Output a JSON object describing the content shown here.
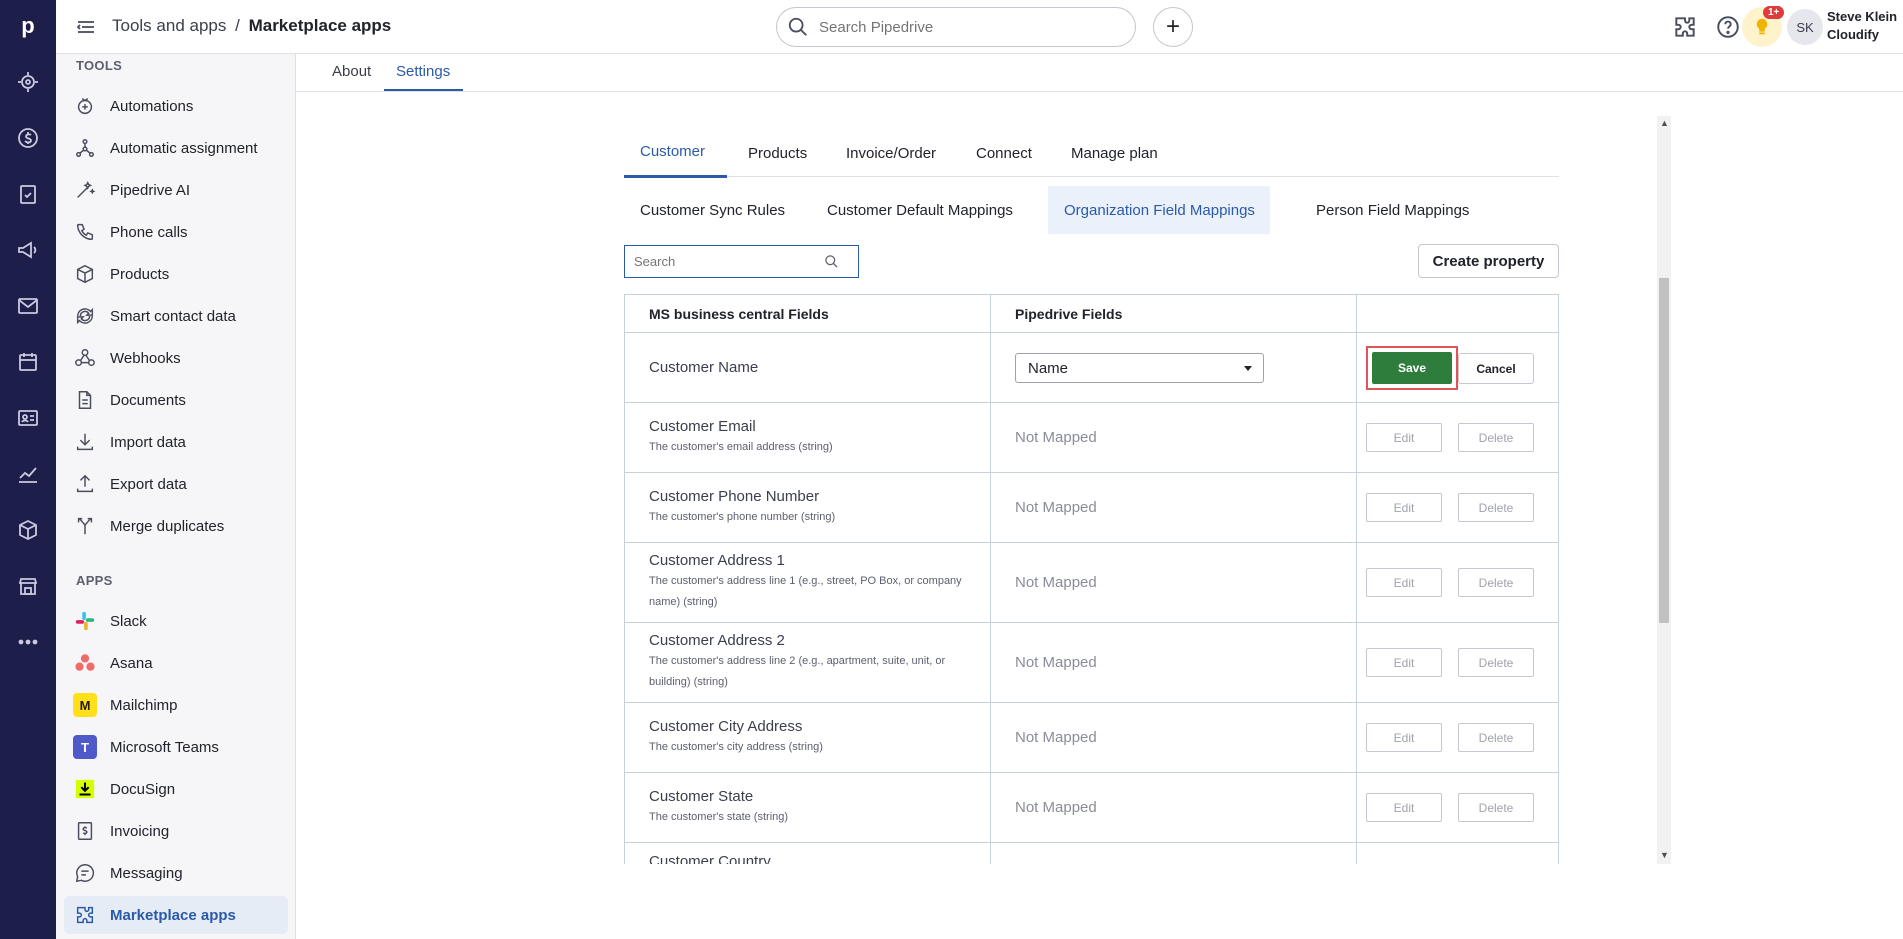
{
  "topbar": {
    "breadcrumb_parent": "Tools and apps",
    "breadcrumb_sep": "/",
    "breadcrumb_current": "Marketplace apps",
    "search_placeholder": "Search Pipedrive",
    "notifications_badge": "1+",
    "avatar_initials": "SK",
    "user_name": "Steve Klein",
    "user_company": "Cloudify"
  },
  "sidebar": {
    "tools_header": "TOOLS",
    "tools": [
      {
        "label": "Automations",
        "icon": "automations-icon"
      },
      {
        "label": "Automatic assignment",
        "icon": "assignment-icon"
      },
      {
        "label": "Pipedrive AI",
        "icon": "ai-wand-icon"
      },
      {
        "label": "Phone calls",
        "icon": "phone-icon"
      },
      {
        "label": "Products",
        "icon": "box-icon"
      },
      {
        "label": "Smart contact data",
        "icon": "sync-icon"
      },
      {
        "label": "Webhooks",
        "icon": "webhook-icon"
      },
      {
        "label": "Documents",
        "icon": "document-icon"
      },
      {
        "label": "Import data",
        "icon": "import-icon"
      },
      {
        "label": "Export data",
        "icon": "export-icon"
      },
      {
        "label": "Merge duplicates",
        "icon": "merge-icon"
      }
    ],
    "apps_header": "APPS",
    "apps": [
      {
        "label": "Slack",
        "icon": "slack-icon"
      },
      {
        "label": "Asana",
        "icon": "asana-icon"
      },
      {
        "label": "Mailchimp",
        "icon": "mailchimp-icon"
      },
      {
        "label": "Microsoft Teams",
        "icon": "teams-icon"
      },
      {
        "label": "DocuSign",
        "icon": "docusign-icon"
      },
      {
        "label": "Invoicing",
        "icon": "invoicing-icon"
      },
      {
        "label": "Messaging",
        "icon": "messaging-icon"
      },
      {
        "label": "Marketplace apps",
        "icon": "marketplace-icon"
      }
    ]
  },
  "page_tabs": [
    {
      "label": "About"
    },
    {
      "label": "Settings"
    }
  ],
  "inner_tabs": [
    {
      "label": "Customer"
    },
    {
      "label": "Products"
    },
    {
      "label": "Invoice/Order"
    },
    {
      "label": "Connect"
    },
    {
      "label": "Manage plan"
    }
  ],
  "sub_tabs": [
    {
      "label": "Customer Sync Rules"
    },
    {
      "label": "Customer Default Mappings"
    },
    {
      "label": "Organization Field Mappings"
    },
    {
      "label": "Person Field Mappings"
    }
  ],
  "table_search_placeholder": "Search",
  "create_property_label": "Create property",
  "table": {
    "headers": [
      "MS business central Fields",
      "Pipedrive Fields"
    ],
    "edit_row": {
      "field": "Customer Name",
      "selected": "Name",
      "save_label": "Save",
      "cancel_label": "Cancel"
    },
    "rows": [
      {
        "field": "Customer Email",
        "desc": "The customer's email address (string)",
        "mapping": "Not Mapped"
      },
      {
        "field": "Customer Phone Number",
        "desc": "The customer's phone number (string)",
        "mapping": "Not Mapped"
      },
      {
        "field": "Customer Address 1",
        "desc": "The customer's address line 1 (e.g., street, PO Box, or company name) (string)",
        "mapping": "Not Mapped"
      },
      {
        "field": "Customer Address 2",
        "desc": "The customer's address line 2 (e.g., apartment, suite, unit, or building) (string)",
        "mapping": "Not Mapped"
      },
      {
        "field": "Customer City Address",
        "desc": "The customer's city address (string)",
        "mapping": "Not Mapped"
      },
      {
        "field": "Customer State",
        "desc": "The customer's state (string)",
        "mapping": "Not Mapped"
      },
      {
        "field": "Customer Country",
        "desc": "",
        "mapping": ""
      }
    ],
    "edit_label": "Edit",
    "delete_label": "Delete"
  },
  "colors": {
    "rail": "#1e1e4a",
    "accent": "#2a5aa8",
    "save": "#2e7d3c",
    "highlight": "#e0555a"
  }
}
